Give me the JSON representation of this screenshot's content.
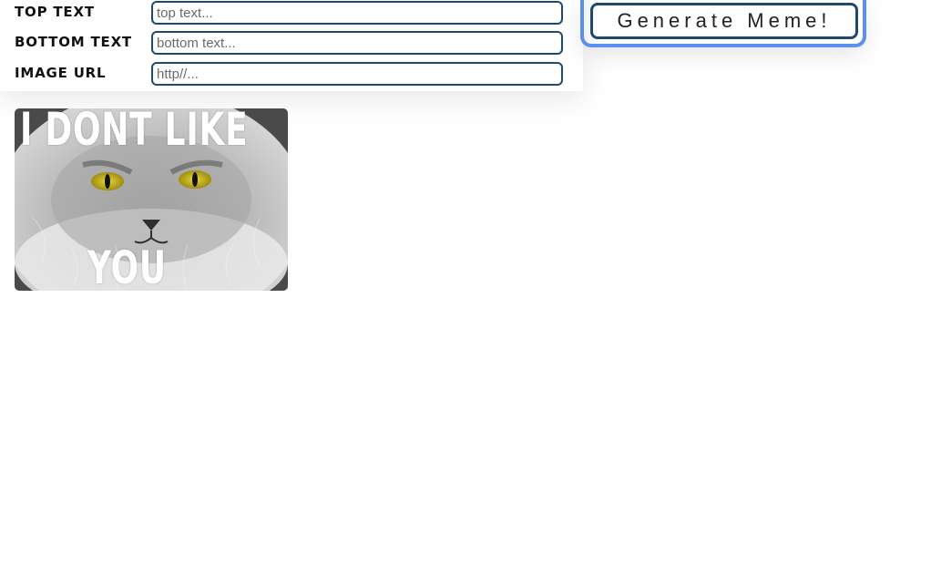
{
  "form": {
    "top_label": "TOP TEXT",
    "top_placeholder": "top text...",
    "bottom_label": "BOTTOM TEXT",
    "bottom_placeholder": "bottom text...",
    "url_label": "IMAGE URL",
    "url_placeholder": "http//..."
  },
  "generate_button": {
    "label": "Generate Meme!"
  },
  "meme": {
    "top_text": "I DONT LIKE",
    "bottom_text": "YOU",
    "image_subject": "grumpy-cat-photo"
  },
  "colors": {
    "input_border": "#1f4a6e",
    "button_focus_ring": "#5b8ff0",
    "cat_eye": "#d4c21a"
  }
}
